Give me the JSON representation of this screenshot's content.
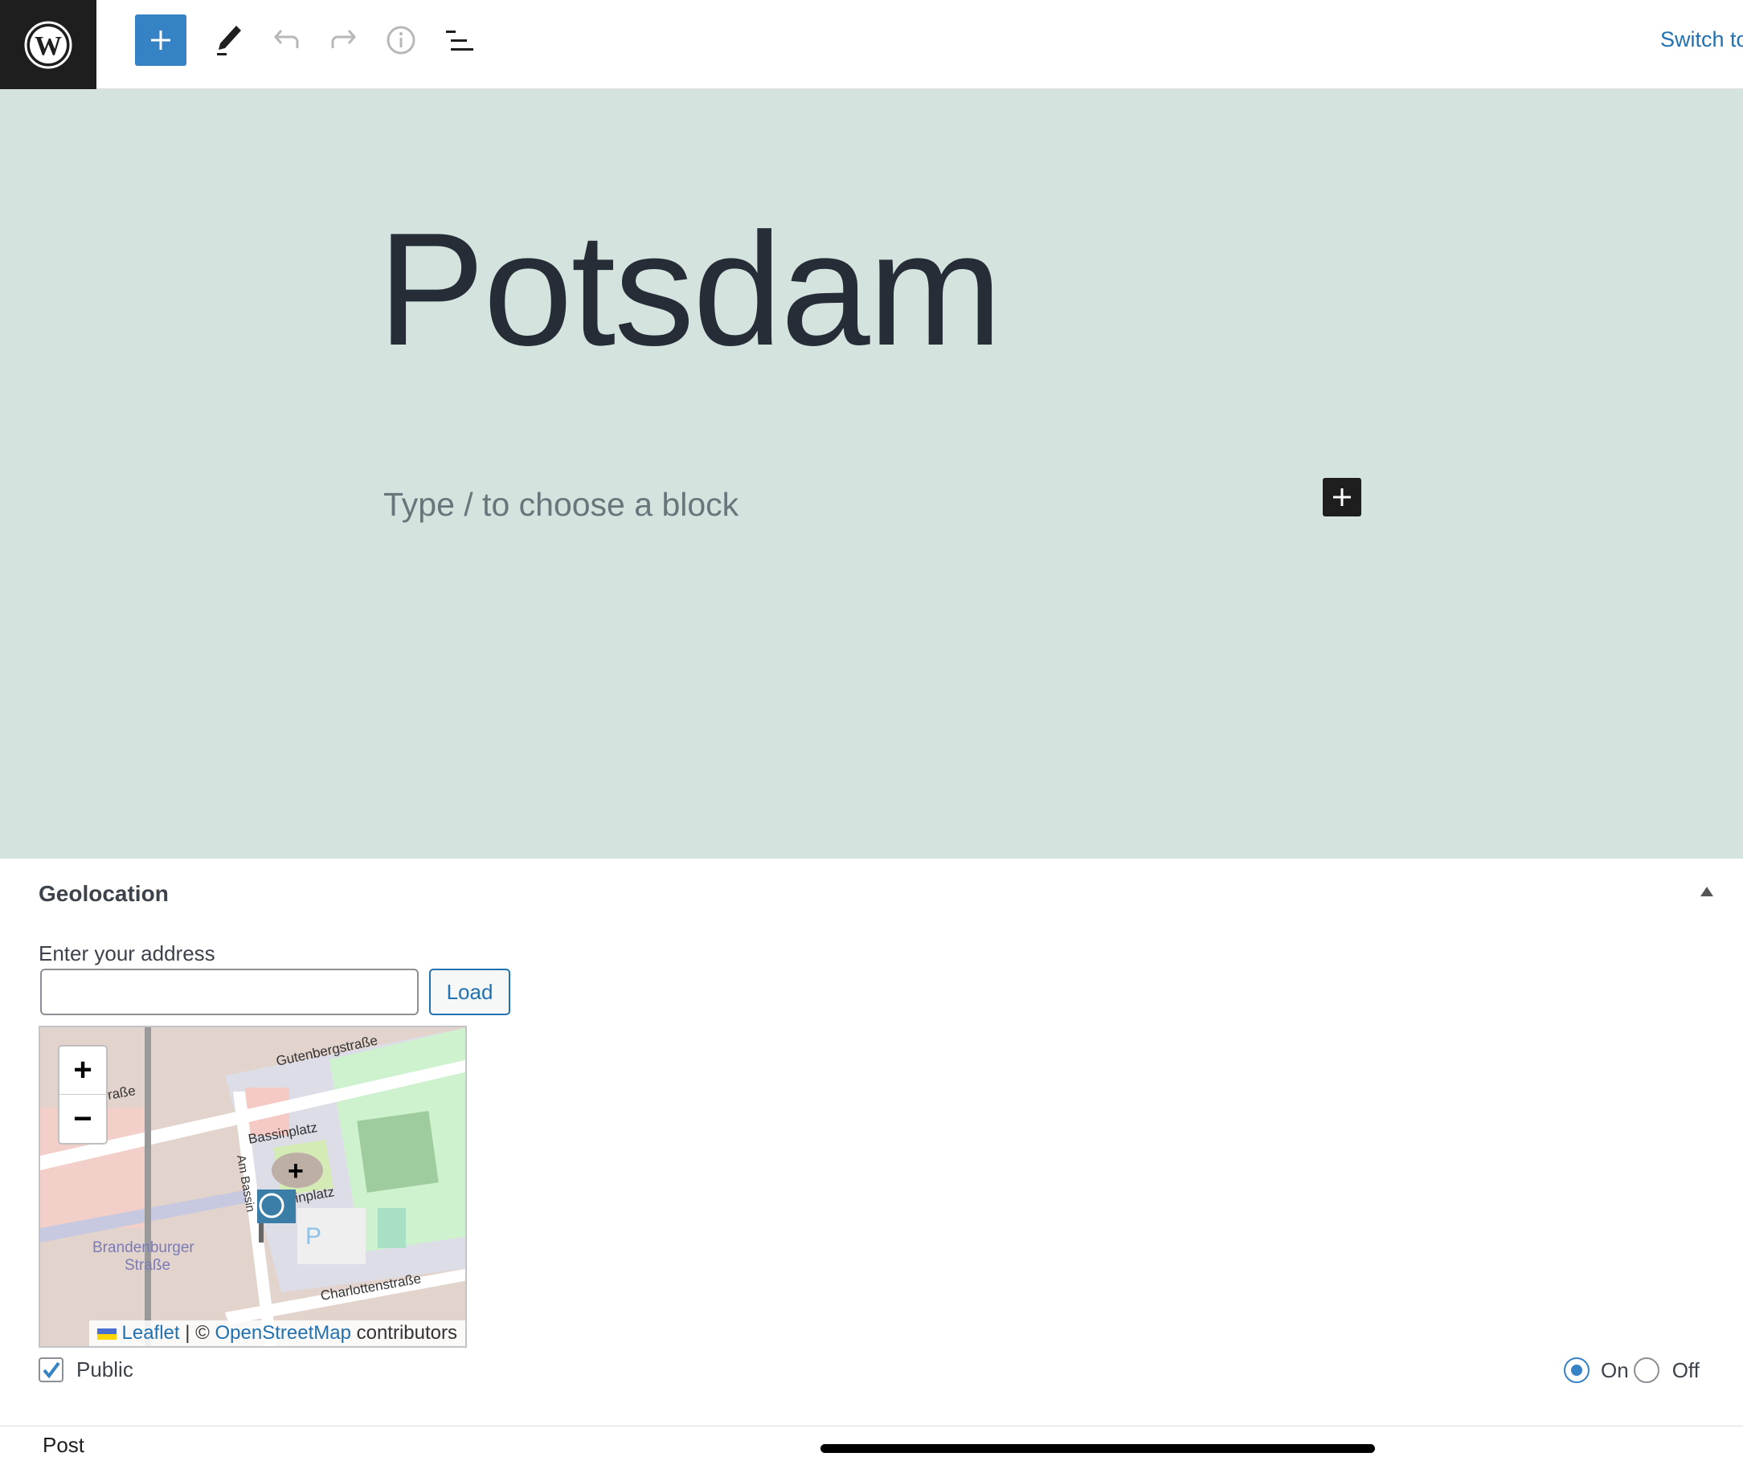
{
  "toolbar": {
    "add_block_icon": "plus-icon",
    "tools_icon": "pencil-icon",
    "undo_icon": "undo-icon",
    "redo_icon": "redo-icon",
    "details_icon": "info-icon",
    "outline_icon": "list-view-icon",
    "switch_label": "Switch to",
    "accent": "#3582c4"
  },
  "editor": {
    "title": "Potsdam",
    "block_placeholder": "Type / to choose a block",
    "background": "#d5e3df"
  },
  "geolocation": {
    "heading": "Geolocation",
    "address_label": "Enter your address",
    "address_value": "",
    "load_label": "Load",
    "map": {
      "zoom_in": "+",
      "zoom_out": "−",
      "labels": [
        "Gutenbergstraße",
        "Bassinplatz",
        "Am Bassin",
        "sinplatz",
        "Brandenburger",
        "Straße",
        "Charlottenstraße",
        "raße",
        "P"
      ],
      "attribution": {
        "leaflet": "Leaflet",
        "separator": "|",
        "copyright": "©",
        "osm": "OpenStreetMap",
        "suffix": "contributors"
      }
    },
    "public_label": "Public",
    "public_checked": true,
    "on_label": "On",
    "off_label": "Off",
    "selected": "On"
  },
  "footer": {
    "breadcrumb": "Post"
  }
}
